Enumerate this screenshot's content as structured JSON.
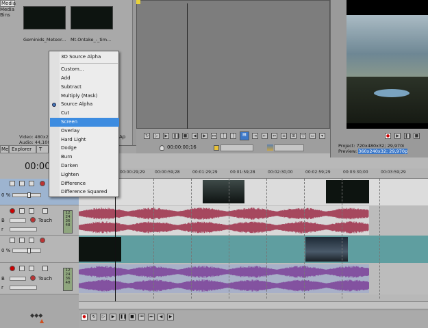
{
  "media": {
    "tab_label": "Media",
    "bins_label": "Media Bins",
    "thumbs": [
      {
        "caption": "Geminids_Meteor..."
      },
      {
        "caption": "Mt.Ontake_-_tim..."
      }
    ],
    "info_video": "Video: 480x27",
    "info_audio": "Audio: 44,100"
  },
  "tabs": [
    {
      "label": "Media"
    },
    {
      "label": "Explorer"
    },
    {
      "label": "T"
    }
  ],
  "side_label_ap": "Ap",
  "trimmer": {
    "time": "00:00:00;16"
  },
  "preview": {
    "project_label": "Project:",
    "project_value": "720x480x32; 29,970i",
    "preview_label": "Preview:",
    "preview_value": "360x240x32; 29,970p"
  },
  "timeline": {
    "timecode": "00:00",
    "ruler_ticks": [
      "00:00:29;29",
      "00:00:59;28",
      "00:01:29;29",
      "00:01:59;28",
      "00:02:30;00",
      "00:02:59;29",
      "00:03:30;00",
      "00:03:59;29"
    ],
    "tracks": [
      {
        "type": "video",
        "level": "0 %"
      },
      {
        "type": "audio",
        "vol": "B",
        "pan": "r",
        "mode": "Touch",
        "meter": [
          "12",
          "24",
          "36",
          "48"
        ]
      },
      {
        "type": "video",
        "level": "0 %"
      },
      {
        "type": "audio",
        "vol": "B",
        "pan": "r",
        "mode": "Touch",
        "meter": [
          "12",
          "24",
          "36",
          "48"
        ]
      }
    ]
  },
  "context_menu": {
    "items": [
      {
        "label": "3D Source Alpha"
      },
      {
        "label": "Custom..."
      },
      {
        "label": "Add"
      },
      {
        "label": "Subtract"
      },
      {
        "label": "Multiply (Mask)"
      },
      {
        "label": "Source Alpha",
        "checked": true
      },
      {
        "label": "Cut"
      },
      {
        "label": "Screen",
        "highlighted": true
      },
      {
        "label": "Overlay"
      },
      {
        "label": "Hard Light"
      },
      {
        "label": "Dodge"
      },
      {
        "label": "Burn"
      },
      {
        "label": "Darken"
      },
      {
        "label": "Lighten"
      },
      {
        "label": "Difference"
      },
      {
        "label": "Difference Squared"
      }
    ]
  },
  "colors": {
    "video_track_bg": "#dcdcdc",
    "video_track2_bg": "#5f9ea0",
    "audio_wave_1": "#9a2440",
    "audio_wave_2": "#7a3a96",
    "highlight": "#3d8ce0"
  }
}
